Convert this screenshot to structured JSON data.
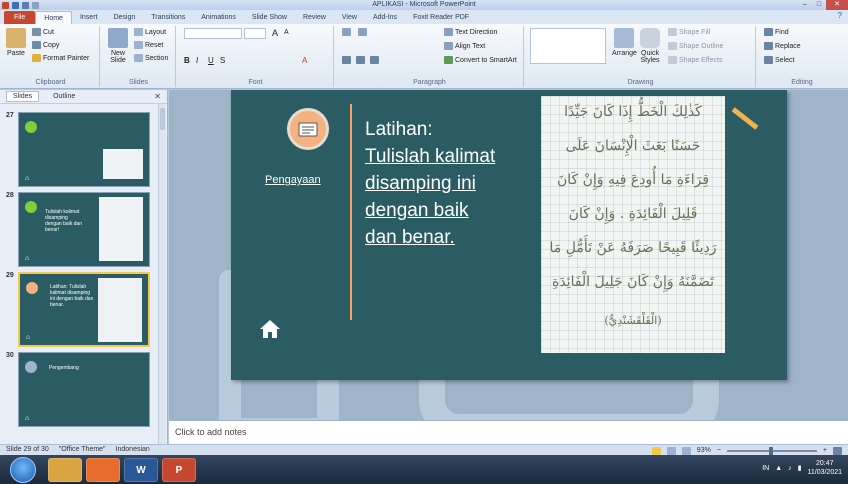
{
  "window": {
    "title": "APLIKASI - Microsoft PowerPoint"
  },
  "tabs": [
    "File",
    "Home",
    "Insert",
    "Design",
    "Transitions",
    "Animations",
    "Slide Show",
    "Review",
    "View",
    "Add-Ins",
    "Foxit Reader PDF"
  ],
  "ribbon": {
    "clipboard": {
      "paste": "Paste",
      "cut": "Cut",
      "copy": "Copy",
      "format_painter": "Format Painter",
      "label": "Clipboard"
    },
    "slides": {
      "new_slide": "New Slide",
      "layout": "Layout",
      "reset": "Reset",
      "section": "Section",
      "label": "Slides"
    },
    "font": {
      "label": "Font"
    },
    "paragraph": {
      "text_direction": "Text Direction",
      "align_text": "Align Text",
      "convert_smartart": "Convert to SmartArt",
      "label": "Paragraph"
    },
    "drawing": {
      "arrange": "Arrange",
      "quick_styles": "Quick Styles",
      "shape_fill": "Shape Fill",
      "shape_outline": "Shape Outline",
      "shape_effects": "Shape Effects",
      "label": "Drawing"
    },
    "editing": {
      "find": "Find",
      "replace": "Replace",
      "select": "Select",
      "label": "Editing"
    }
  },
  "pane": {
    "tabs": [
      "Slides",
      "Outline"
    ],
    "thumbs": [
      {
        "num": "27",
        "text": ""
      },
      {
        "num": "28",
        "text": "Tulislah kalimat disamping dengan baik dan benar!"
      },
      {
        "num": "29",
        "text": "Latihan: Tulislah kalimat disamping ini dengan baik dan benar."
      },
      {
        "num": "30",
        "text": "Pengembang"
      }
    ]
  },
  "slide": {
    "heading": "Latihan:",
    "lines": [
      "Tulislah kalimat",
      "disamping ini",
      "dengan baik",
      "dan benar."
    ],
    "pengayaan": "Pengayaan",
    "arabic_lines": [
      "كَذٰلِكَ الْخَطُّ إِذَا كَانَ جَيِّدًا",
      "حَسَنًا بَعَثَ الْإِنْسَانَ عَلَى",
      "قِرَاءَةِ مَا أُودِعَ فِيهِ وَإِنْ كَانَ",
      "قَلِيلَ الْفَائِدَةِ . وَإِنْ كَانَ",
      "رَدِيئًا قَبِيحًا صَرَفَهُ عَنْ تَأَمُّلِ مَا",
      "تَضَمَّنَهُ وَإِنْ كَانَ جَلِيلَ الْفَائِدَةِ",
      "(الْقَلْقَشَنْدِيُّ)"
    ]
  },
  "notes": {
    "placeholder": "Click to add notes"
  },
  "status": {
    "slide": "Slide 29 of 30",
    "theme": "\"Office Theme\"",
    "language": "Indonesian",
    "zoom": "93%"
  },
  "taskbar": {
    "lang": "IN",
    "time": "20:47",
    "date": "11/03/2021"
  },
  "colors": {
    "slide_bg": "#2b5c64",
    "accent": "#f7a35c",
    "circle": "#f6b183",
    "file_tab": "#c5472f"
  }
}
